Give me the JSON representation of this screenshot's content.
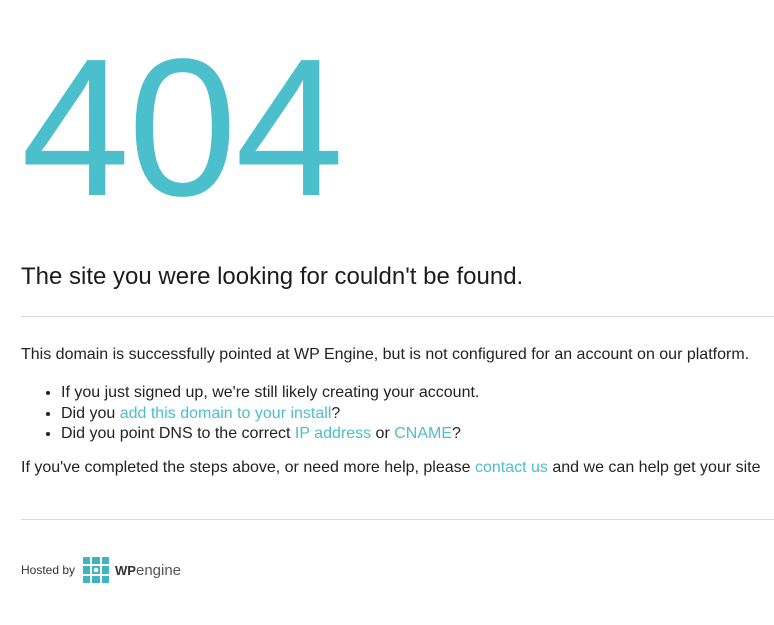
{
  "error": {
    "code": "404",
    "headline": "The site you were looking for couldn't be found."
  },
  "intro": "This domain is successfully pointed at WP Engine, but is not configured for an account on our platform.",
  "tips": {
    "item1": "If you just signed up, we're still likely creating your account.",
    "item2": {
      "prefix": "Did you ",
      "link": "add this domain to your install",
      "suffix": "?"
    },
    "item3": {
      "prefix": "Did you point DNS to the correct ",
      "link1": "IP address",
      "middle": " or ",
      "link2": "CNAME",
      "suffix": "?"
    }
  },
  "help": {
    "prefix": "If you've completed the steps above, or need more help, please ",
    "link": "contact us",
    "suffix": " and we can help get your site"
  },
  "footer": {
    "hosted_by": "Hosted by",
    "logo_wp": "WP",
    "logo_engine": "engine"
  },
  "colors": {
    "accent": "#4bbfcb",
    "logo": "#3fb5c1"
  }
}
